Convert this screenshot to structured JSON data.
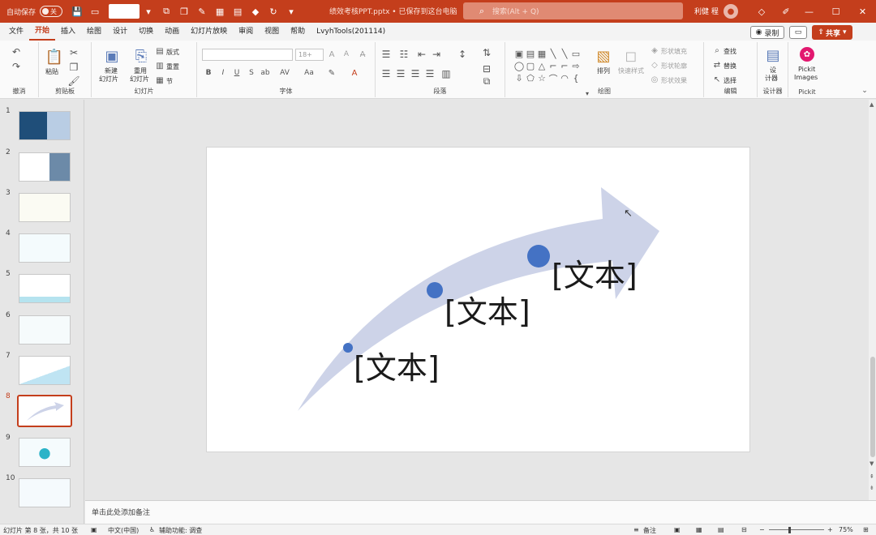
{
  "titlebar": {
    "autosave_label": "自动保存",
    "autosave_state": "关",
    "doc_title": "绩效考核PPT.pptx • 已保存到这台电脑",
    "search_placeholder": "搜索(Alt + Q)",
    "user_name": "利健 程"
  },
  "menu": {
    "items": [
      "文件",
      "开始",
      "插入",
      "绘图",
      "设计",
      "切换",
      "动画",
      "幻灯片放映",
      "审阅",
      "视图",
      "帮助",
      "LvyhTools(201114)"
    ],
    "active": "开始",
    "record_label": "录制",
    "share_label": "共享"
  },
  "ribbon": {
    "groups": {
      "undo": "撤消",
      "clipboard": "剪贴板",
      "slides": "幻灯片",
      "font": "字体",
      "paragraph": "段落",
      "drawing": "绘图",
      "editing": "编辑",
      "designer": "设计器",
      "pickit": "Pickit"
    },
    "paste_label": "粘贴",
    "new_slide_label": [
      "新建",
      "幻灯片"
    ],
    "reuse_slide_label": [
      "重用",
      "幻灯片"
    ],
    "layout_label": "版式",
    "reset_label": "重置",
    "section_label": "节",
    "font_size_placeholder": "18+",
    "arrange_label": "排列",
    "quick_styles_label": "快速样式",
    "shape_fill_label": "形状填充",
    "shape_outline_label": "形状轮廓",
    "shape_effects_label": "形状效果",
    "find_label": "查找",
    "replace_label": "替换",
    "select_label": "选择",
    "designer_label": [
      "设",
      "计器"
    ],
    "pickit_label": [
      "Pickit",
      "Images"
    ]
  },
  "thumbnails": {
    "numbers": [
      "1",
      "2",
      "3",
      "4",
      "5",
      "6",
      "7",
      "8",
      "9",
      "10"
    ],
    "active_index": 8
  },
  "slide": {
    "text1": "[文本]",
    "text2": "[文本]",
    "text3": "[文本]",
    "arrow_color": "#cdd3e8",
    "dot_color": "#4472c4"
  },
  "notes": {
    "placeholder": "单击此处添加备注"
  },
  "statusbar": {
    "slide_info": "幻灯片 第 8 张，共 10 张",
    "language": "中文(中国)",
    "accessibility": "辅助功能: 调查",
    "notes_label": "备注",
    "zoom": "75%"
  },
  "colors": {
    "accent": "#c43e1c"
  }
}
